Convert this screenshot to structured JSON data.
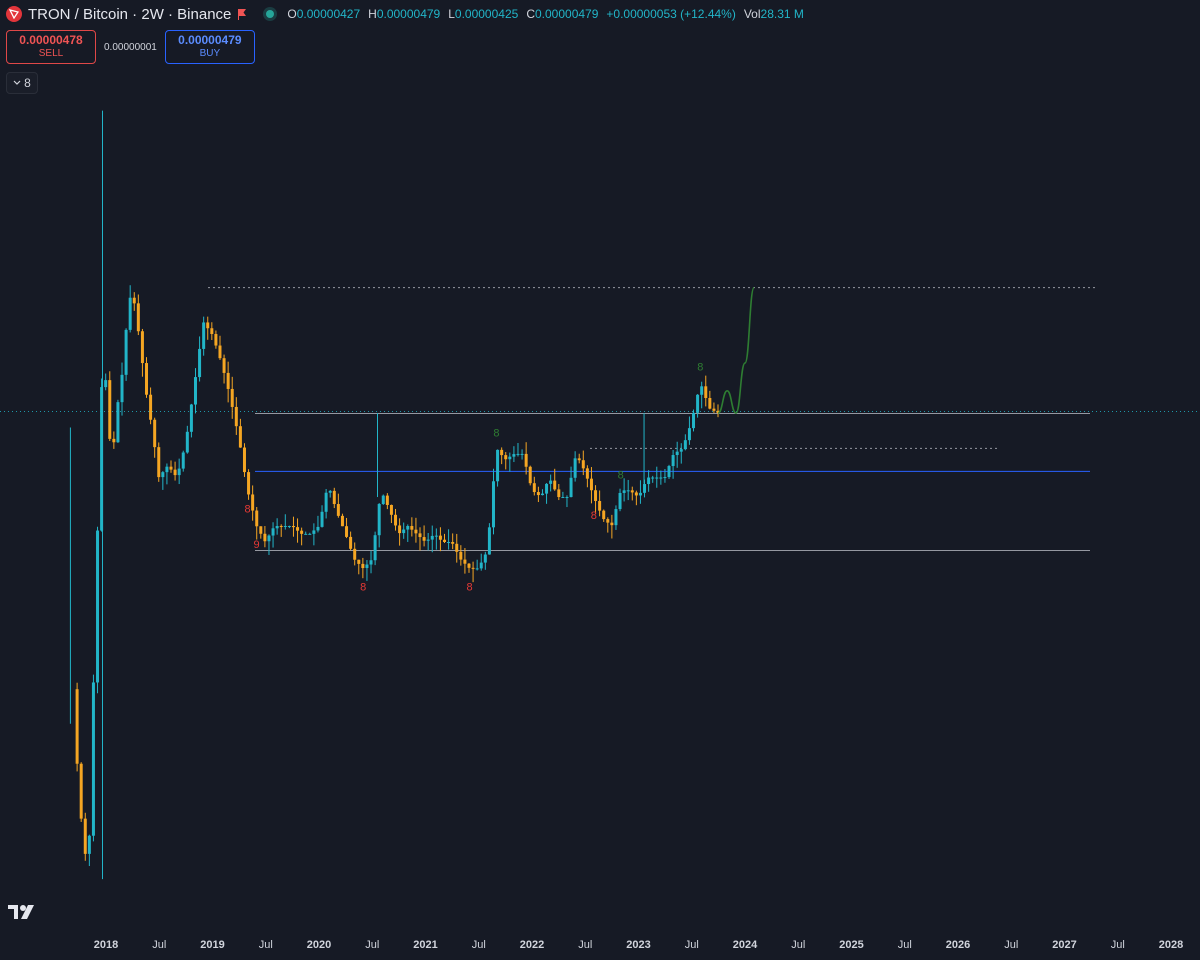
{
  "header": {
    "title": "TRON / Bitcoin · 2W · Binance",
    "ohlc": [
      {
        "k": "O",
        "v": "0.00000427"
      },
      {
        "k": "H",
        "v": "0.00000479"
      },
      {
        "k": "L",
        "v": "0.00000425"
      },
      {
        "k": "C",
        "v": "0.00000479"
      },
      {
        "k": "",
        "v": "+0.00000053 (+12.44%)"
      },
      {
        "k": "Vol",
        "v": "28.31 M"
      }
    ]
  },
  "trade": {
    "sell_price": "0.00000478",
    "sell_label": "SELL",
    "spread": "0.00000001",
    "buy_price": "0.00000479",
    "buy_label": "BUY"
  },
  "indicator_toggle": {
    "label": "8"
  },
  "colors": {
    "background": "#161a25",
    "up": "#22b5c8",
    "down": "#f5a623",
    "projection": "#2e7d32",
    "level": "#9598a1",
    "mid_level": "#2962ff",
    "signal_red": "#e53935",
    "signal_green": "#2e7d32"
  },
  "chart_data": {
    "type": "candlestick",
    "symbol": "TRX/BTC",
    "interval": "2W",
    "exchange": "Binance",
    "x_tick_labels": [
      "2018",
      "Jul",
      "2019",
      "Jul",
      "2020",
      "Jul",
      "2021",
      "Jul",
      "2022",
      "Jul",
      "2023",
      "Jul",
      "2024",
      "Jul",
      "2025",
      "Jul",
      "2026",
      "Jul",
      "2027",
      "Jul",
      "2028"
    ],
    "y_range": [
      5e-07,
      1.94e-05
    ],
    "level_lines": [
      {
        "kind": "resistance",
        "value": 4.79e-06
      },
      {
        "kind": "mid",
        "value": 3.7e-06
      },
      {
        "kind": "support",
        "value": 2.6e-06
      },
      {
        "kind": "dotted-target",
        "value": 8.4e-06
      },
      {
        "kind": "dotted-mid",
        "value": 4.1e-06
      }
    ],
    "close_series": [
      [
        "2017-09-10",
        1.4e-06
      ],
      [
        "2017-10-01",
        8.5e-07
      ],
      [
        "2017-11-01",
        6e-07
      ],
      [
        "2017-12-01",
        2.6e-06
      ],
      [
        "2017-12-20",
        6.2e-06
      ],
      [
        "2018-01-01",
        5.5e-06
      ],
      [
        "2018-01-20",
        3.8e-06
      ],
      [
        "2018-02-10",
        5e-06
      ],
      [
        "2018-03-01",
        5.9e-06
      ],
      [
        "2018-03-20",
        8.1e-06
      ],
      [
        "2018-04-10",
        7.8e-06
      ],
      [
        "2018-05-01",
        6.3e-06
      ],
      [
        "2018-05-20",
        5.2e-06
      ],
      [
        "2018-06-10",
        4.4e-06
      ],
      [
        "2018-07-01",
        3.6e-06
      ],
      [
        "2018-08-01",
        3.8e-06
      ],
      [
        "2018-09-01",
        3.6e-06
      ],
      [
        "2018-10-01",
        4.2e-06
      ],
      [
        "2018-11-01",
        5.5e-06
      ],
      [
        "2018-12-01",
        7.2e-06
      ],
      [
        "2019-01-01",
        6.8e-06
      ],
      [
        "2019-02-01",
        6e-06
      ],
      [
        "2019-03-01",
        5.2e-06
      ],
      [
        "2019-04-01",
        4.3e-06
      ],
      [
        "2019-05-01",
        3.4e-06
      ],
      [
        "2019-06-01",
        2.9e-06
      ],
      [
        "2019-07-01",
        2.7e-06
      ],
      [
        "2019-08-01",
        2.9e-06
      ],
      [
        "2019-09-01",
        2.9e-06
      ],
      [
        "2019-10-01",
        2.9e-06
      ],
      [
        "2019-11-01",
        2.8e-06
      ],
      [
        "2019-12-01",
        2.8e-06
      ],
      [
        "2020-01-01",
        2.9e-06
      ],
      [
        "2020-02-01",
        3.5e-06
      ],
      [
        "2020-03-01",
        3.1e-06
      ],
      [
        "2020-04-01",
        2.8e-06
      ],
      [
        "2020-05-01",
        2.5e-06
      ],
      [
        "2020-06-01",
        2.4e-06
      ],
      [
        "2020-07-01",
        2.5e-06
      ],
      [
        "2020-08-01",
        3.4e-06
      ],
      [
        "2020-09-01",
        3.1e-06
      ],
      [
        "2020-10-01",
        2.8e-06
      ],
      [
        "2020-11-01",
        2.9e-06
      ],
      [
        "2020-12-01",
        2.8e-06
      ],
      [
        "2021-01-01",
        2.7e-06
      ],
      [
        "2021-02-01",
        2.8e-06
      ],
      [
        "2021-03-01",
        2.7e-06
      ],
      [
        "2021-04-01",
        2.7e-06
      ],
      [
        "2021-05-01",
        2.5e-06
      ],
      [
        "2021-06-01",
        2.4e-06
      ],
      [
        "2021-07-01",
        2.4e-06
      ],
      [
        "2021-08-01",
        2.6e-06
      ],
      [
        "2021-09-01",
        4.1e-06
      ],
      [
        "2021-10-01",
        3.9e-06
      ],
      [
        "2021-11-01",
        4e-06
      ],
      [
        "2021-12-01",
        4e-06
      ],
      [
        "2022-01-01",
        3.4e-06
      ],
      [
        "2022-02-01",
        3.3e-06
      ],
      [
        "2022-03-01",
        3.6e-06
      ],
      [
        "2022-04-01",
        3.3e-06
      ],
      [
        "2022-05-01",
        3.3e-06
      ],
      [
        "2022-06-01",
        4e-06
      ],
      [
        "2022-07-01",
        3.7e-06
      ],
      [
        "2022-08-01",
        3.3e-06
      ],
      [
        "2022-09-01",
        3e-06
      ],
      [
        "2022-10-01",
        2.9e-06
      ],
      [
        "2022-11-01",
        3.4e-06
      ],
      [
        "2022-12-01",
        3.4e-06
      ],
      [
        "2023-01-01",
        3.3e-06
      ],
      [
        "2023-02-01",
        3.6e-06
      ],
      [
        "2023-03-01",
        3.6e-06
      ],
      [
        "2023-04-01",
        3.6e-06
      ],
      [
        "2023-05-01",
        4e-06
      ],
      [
        "2023-06-01",
        4.1e-06
      ],
      [
        "2023-07-01",
        4.6e-06
      ],
      [
        "2023-08-01",
        5.5e-06
      ],
      [
        "2023-09-01",
        4.9e-06
      ],
      [
        "2023-10-01",
        4.8e-06
      ]
    ],
    "projection": [
      [
        "2023-10-01",
        4.8e-06
      ],
      [
        "2023-11-01",
        5.3e-06
      ],
      [
        "2023-12-01",
        4.8e-06
      ],
      [
        "2024-01-01",
        6e-06
      ],
      [
        "2024-02-01",
        8.4e-06
      ]
    ],
    "signals": [
      {
        "text": "8",
        "color": "red",
        "date": "2019-05-01"
      },
      {
        "text": "9",
        "color": "red",
        "date": "2019-06-01"
      },
      {
        "text": "8",
        "color": "red",
        "date": "2020-06-01"
      },
      {
        "text": "8",
        "color": "red",
        "date": "2021-06-01"
      },
      {
        "text": "8",
        "color": "green",
        "date": "2021-09-01"
      },
      {
        "text": "8",
        "color": "red",
        "date": "2022-08-01"
      },
      {
        "text": "8",
        "color": "green",
        "date": "2022-11-01"
      },
      {
        "text": "8",
        "color": "green",
        "date": "2023-08-01"
      }
    ]
  }
}
